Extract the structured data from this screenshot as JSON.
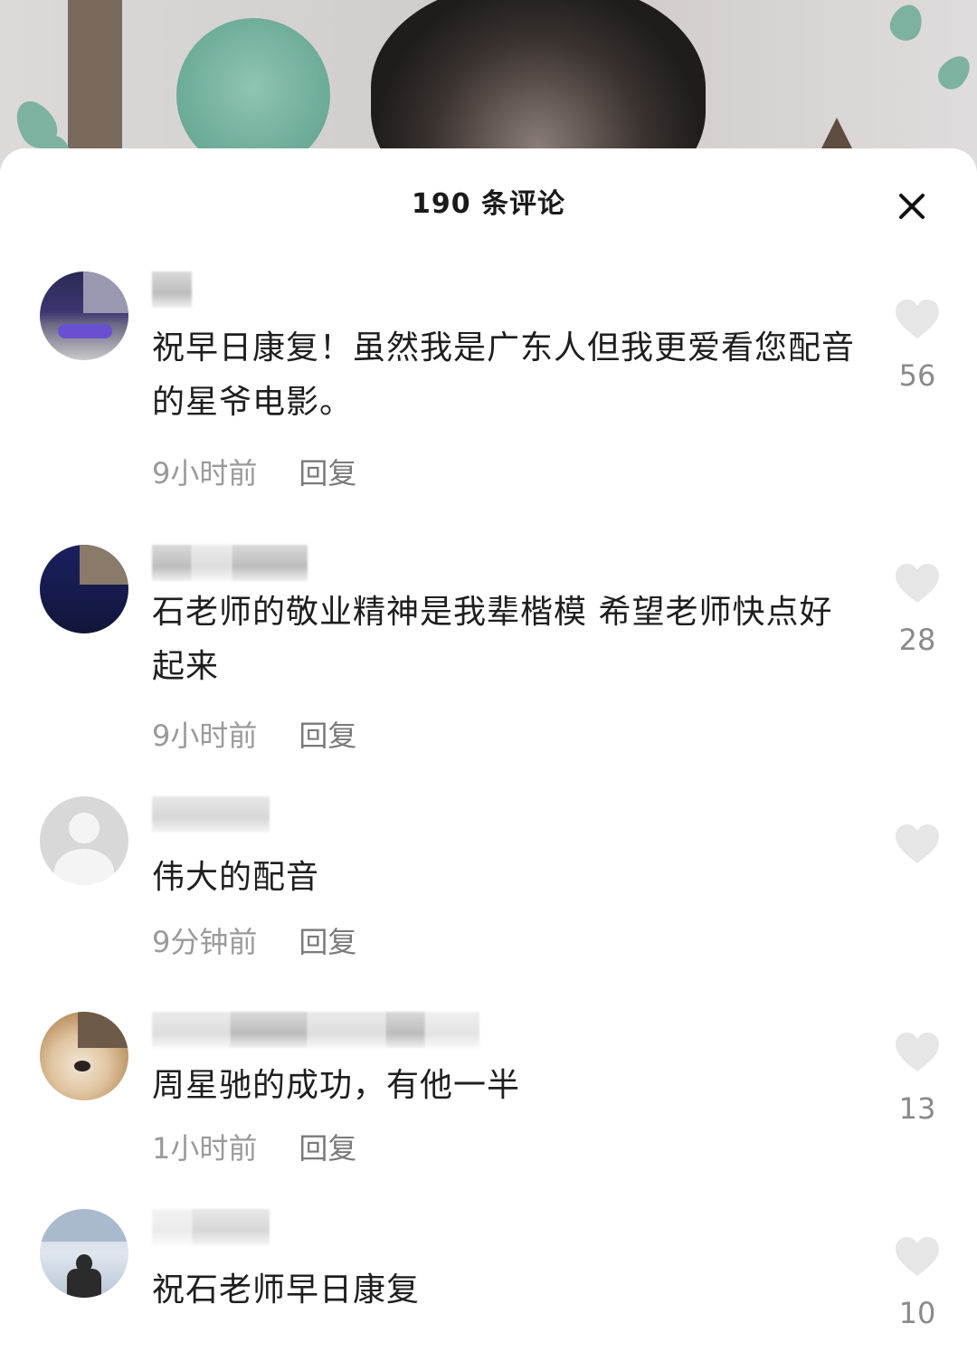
{
  "header": {
    "title": "190 条评论",
    "close_icon": "close-icon"
  },
  "comments": [
    {
      "text": "祝早日康复！虽然我是广东人但我更爱看您配音的星爷电影。",
      "time": "9小时前",
      "reply_label": "回复",
      "likes": "56"
    },
    {
      "text": "石老师的敬业精神是我辈楷模 希望老师快点好起来",
      "time": "9小时前",
      "reply_label": "回复",
      "likes": "28"
    },
    {
      "text": "伟大的配音",
      "time": "9分钟前",
      "reply_label": "回复",
      "likes": ""
    },
    {
      "text": "周星驰的成功，有他一半",
      "time": "1小时前",
      "reply_label": "回复",
      "likes": "13"
    },
    {
      "text": "祝石老师早日康复",
      "time": "",
      "reply_label": "",
      "likes": "10"
    }
  ],
  "colors": {
    "heart": "#e6e6e6",
    "meta": "#9a9a9a",
    "text": "#1e1e1e"
  }
}
